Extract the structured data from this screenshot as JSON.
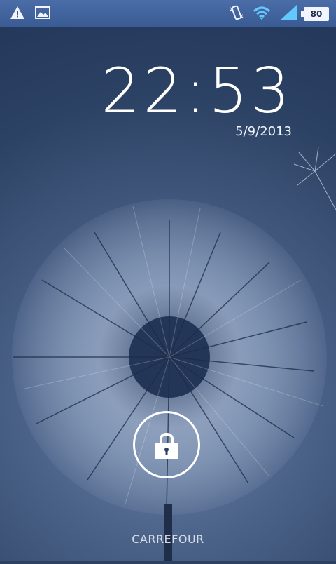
{
  "status_bar": {
    "battery_level": "80",
    "icons": [
      "warning-icon",
      "image-icon",
      "vibrate-icon",
      "wifi-icon",
      "signal-icon",
      "battery-icon"
    ]
  },
  "lockscreen": {
    "time": "22:53",
    "date": "5/9/2013",
    "carrier": "CARREFOUR"
  },
  "colors": {
    "statusbar_top": "#4b6da8",
    "wallpaper_primary": "#2d4263",
    "text_primary": "#ffffff"
  }
}
